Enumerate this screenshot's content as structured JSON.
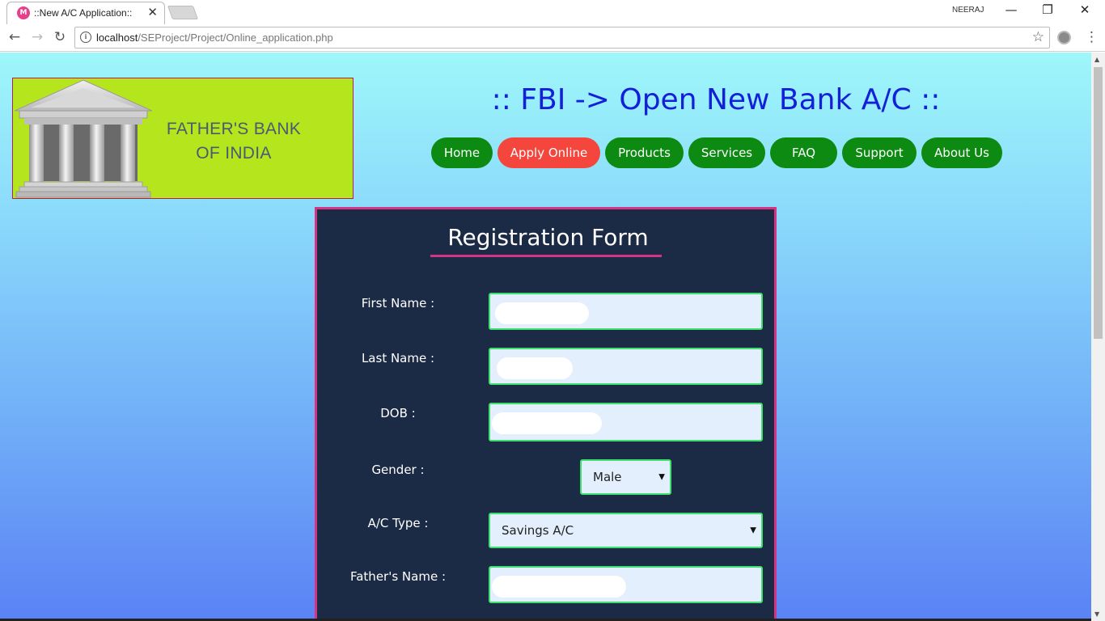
{
  "browser": {
    "tab_title": "::New A/C Application::",
    "tab_favicon": "M",
    "tab_close": "✕",
    "profile_name": "NEERAJ",
    "window_controls": {
      "minimize": "—",
      "restore": "❐",
      "close": "✕"
    },
    "nav_icons": {
      "back": "←",
      "forward": "→",
      "reload": "↻"
    },
    "url_host": "localhost",
    "url_path": "/SEProject/Project/Online_application.php",
    "info_icon": "i",
    "star_icon": "☆",
    "menu_icon": "⋮"
  },
  "header": {
    "logo_line1": "FATHER'S BANK",
    "logo_line2": "OF INDIA",
    "title": ":: FBI -> Open New Bank A/C ::"
  },
  "nav": {
    "items": [
      {
        "label": "Home",
        "active": false
      },
      {
        "label": "Apply Online",
        "active": true
      },
      {
        "label": "Products",
        "active": false
      },
      {
        "label": "Services",
        "active": false
      },
      {
        "label": "FAQ",
        "active": false
      },
      {
        "label": "Support",
        "active": false
      },
      {
        "label": "About Us",
        "active": false
      }
    ]
  },
  "form": {
    "title": "Registration Form",
    "first_name_label": "First Name :",
    "last_name_label": "Last Name :",
    "dob_label": "DOB :",
    "gender_label": "Gender :",
    "gender_value": "Male",
    "ac_type_label": "A/C Type :",
    "ac_type_value": "Savings A/C",
    "father_name_label": "Father's Name :",
    "select_arrow": "▼"
  },
  "colors": {
    "nav_green": "#0c8a12",
    "nav_active_red": "#f4463c",
    "title_blue": "#1420d8",
    "form_bg": "#1c2b45",
    "form_border_pink": "#d63384",
    "input_border_green": "#3ee06b",
    "logo_bg": "#b5e61d"
  }
}
